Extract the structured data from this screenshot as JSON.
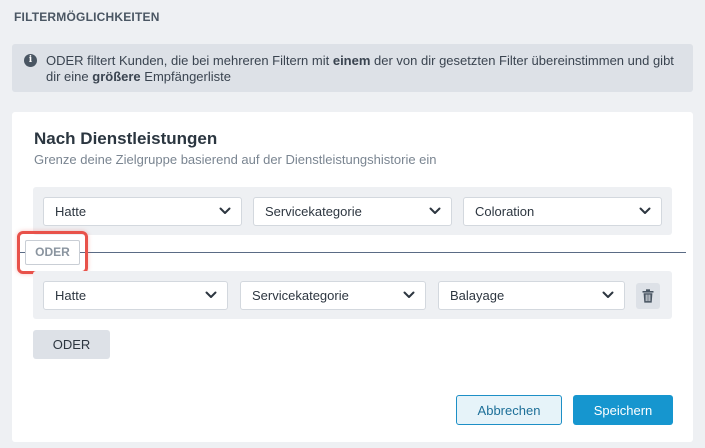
{
  "section_title": "FILTERMÖGLICHKEITEN",
  "info": {
    "icon": "info-icon",
    "text_prefix": "ODER filtert Kunden, die bei mehreren Filtern mit ",
    "text_bold1": "einem",
    "text_middle": " der von dir gesetzten Filter übereinstimmen und gibt dir eine ",
    "text_bold2": "größere",
    "text_suffix": " Empfängerliste"
  },
  "card": {
    "title": "Nach Dienstleistungen",
    "subtitle": "Grenze deine Zielgruppe basierend auf der Dienstleistungshistorie ein"
  },
  "filter_groups": [
    {
      "selects": [
        "Hatte",
        "Servicekategorie",
        "Coloration"
      ]
    },
    {
      "selects": [
        "Hatte",
        "Servicekategorie",
        "Balayage"
      ]
    }
  ],
  "separator_label": "ODER",
  "add_oder_label": "ODER",
  "buttons": {
    "cancel": "Abbrechen",
    "save": "Speichern"
  },
  "colors": {
    "accent": "#1696cf",
    "highlight": "#e8524a"
  }
}
